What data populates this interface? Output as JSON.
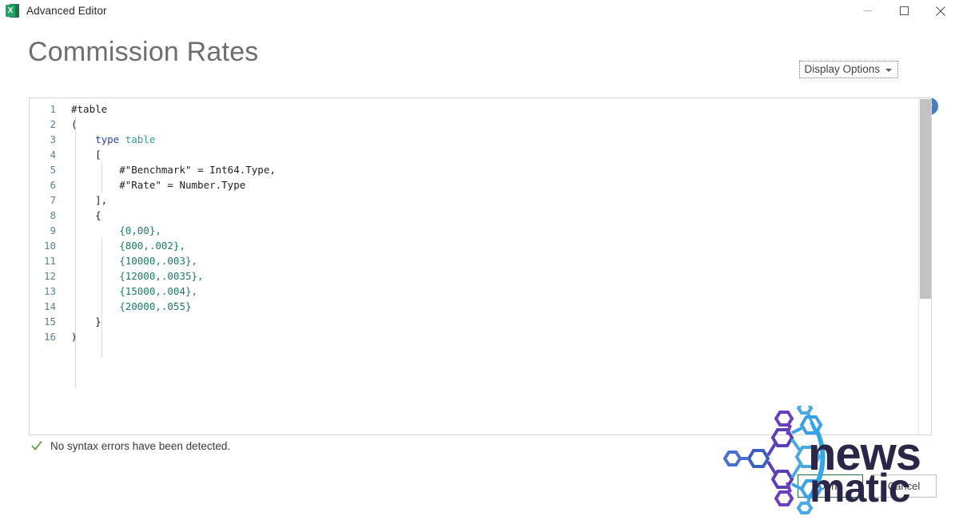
{
  "window": {
    "app_icon": "excel-icon",
    "icon_letter": "X",
    "title": "Advanced Editor",
    "controls": {
      "minimize": "minimize-icon",
      "maximize": "maximize-icon",
      "close": "close-icon"
    }
  },
  "header": {
    "page_title": "Commission Rates",
    "display_options_label": "Display Options",
    "display_options_caret": "chevron-down-icon",
    "help_label": "?",
    "help_icon": "help-circle-icon"
  },
  "editor": {
    "lines": [
      {
        "n": "1",
        "tokens": [
          {
            "t": "#table",
            "c": "plain"
          }
        ]
      },
      {
        "n": "2",
        "tokens": [
          {
            "t": "(",
            "c": "plain"
          }
        ]
      },
      {
        "n": "3",
        "tokens": [
          {
            "t": "    ",
            "c": "plain"
          },
          {
            "t": "type",
            "c": "kw"
          },
          {
            "t": " ",
            "c": "plain"
          },
          {
            "t": "table",
            "c": "type"
          }
        ]
      },
      {
        "n": "4",
        "tokens": [
          {
            "t": "    [",
            "c": "plain"
          }
        ]
      },
      {
        "n": "5",
        "tokens": [
          {
            "t": "        #\"Benchmark\" = Int64.Type,",
            "c": "plain"
          }
        ]
      },
      {
        "n": "6",
        "tokens": [
          {
            "t": "        #\"Rate\" = Number.Type",
            "c": "plain"
          }
        ]
      },
      {
        "n": "7",
        "tokens": [
          {
            "t": "    ],",
            "c": "plain"
          }
        ]
      },
      {
        "n": "8",
        "tokens": [
          {
            "t": "    {",
            "c": "plain"
          }
        ]
      },
      {
        "n": "9",
        "tokens": [
          {
            "t": "        {",
            "c": "num"
          },
          {
            "t": "0",
            "c": "num"
          },
          {
            "t": ",",
            "c": "num"
          },
          {
            "t": "00",
            "c": "num"
          },
          {
            "t": "},",
            "c": "num"
          }
        ]
      },
      {
        "n": "10",
        "tokens": [
          {
            "t": "        {800,.002},",
            "c": "num"
          }
        ]
      },
      {
        "n": "11",
        "tokens": [
          {
            "t": "        {10000,.003},",
            "c": "num"
          }
        ]
      },
      {
        "n": "12",
        "tokens": [
          {
            "t": "        {12000,.0035},",
            "c": "num"
          }
        ]
      },
      {
        "n": "13",
        "tokens": [
          {
            "t": "        {15000,.004},",
            "c": "num"
          }
        ]
      },
      {
        "n": "14",
        "tokens": [
          {
            "t": "        {20000,.055}",
            "c": "num"
          }
        ]
      },
      {
        "n": "15",
        "tokens": [
          {
            "t": "    }",
            "c": "plain"
          }
        ]
      },
      {
        "n": "16",
        "tokens": [
          {
            "t": ")",
            "c": "plain"
          }
        ]
      }
    ],
    "scrollbar": "vertical-scrollbar"
  },
  "table_data": {
    "type": "table",
    "columns": [
      "Benchmark",
      "Rate"
    ],
    "column_types": [
      "Int64.Type",
      "Number.Type"
    ],
    "rows": [
      [
        "0",
        "00"
      ],
      [
        "800",
        ".002"
      ],
      [
        "10000",
        ".003"
      ],
      [
        "12000",
        ".0035"
      ],
      [
        "15000",
        ".004"
      ],
      [
        "20000",
        ".055"
      ]
    ]
  },
  "status": {
    "icon": "check-icon",
    "message": "No syntax errors have been detected."
  },
  "footer": {
    "done_label": "Done",
    "cancel_label": "Cancel"
  },
  "watermark": {
    "brand_top": "news",
    "brand_bottom": "matic",
    "logo": "hexagon-molecule-icon"
  },
  "colors": {
    "excel_green": "#21a366",
    "done_border": "#217346",
    "help_blue": "#4a7ebb",
    "check_green": "#6aa84f",
    "keyword": "#2b45a8",
    "type": "#2e9a9a",
    "number": "#1d7a6c",
    "line_number": "#5c8290",
    "title_gray": "#6e6e6e",
    "watermark_navy": "#2b2548"
  }
}
